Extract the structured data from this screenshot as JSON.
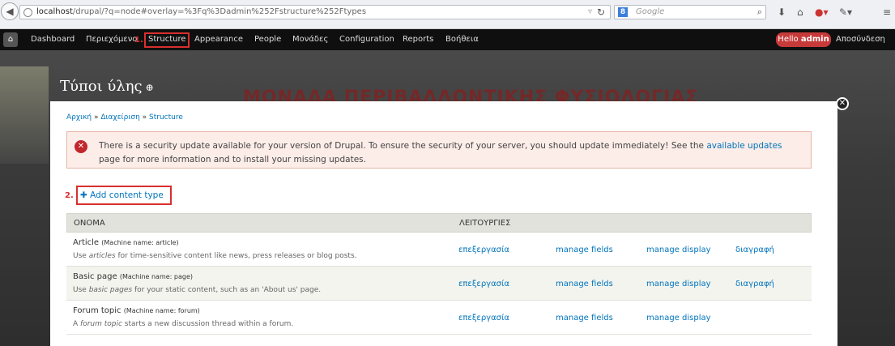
{
  "browser": {
    "url_host": "localhost",
    "url_rest": "/drupal/?q=node#overlay=%3Fq%3Dadmin%252Fstructure%252Ftypes",
    "search_placeholder": "Google",
    "search_engine_letter": "8"
  },
  "toolbar": {
    "items": [
      "Dashboard",
      "Περιεχόμενο",
      "Structure",
      "Appearance",
      "People",
      "Μονάδες",
      "Configuration",
      "Reports",
      "Βοήθεια"
    ],
    "step1": "1.",
    "hello_prefix": "Hello ",
    "hello_user": "admin",
    "logout": "Αποσύνδεση"
  },
  "background": {
    "banner": "ΜΟΝΑΔΑ ΠΕΡΙΒΑΛΛΟΝΤΙΚΗΣ ΦΥΣΙΟΛΟΓΙΑΣ",
    "page_title": "Τύποι ύλης",
    "page_title_icon": "⊕"
  },
  "overlay": {
    "breadcrumb": [
      "Αρχική",
      "Διαχείριση",
      "Structure"
    ],
    "breadcrumb_sep": " » ",
    "message_pre": "There is a security update available for your version of Drupal. To ensure the security of your server, you should update immediately! See the ",
    "message_link": "available updates",
    "message_post": " page for more information and to install your missing updates.",
    "step2": "2.",
    "add_link": "✚ Add content type"
  },
  "table": {
    "headers": [
      "ΟΝΟΜΑ",
      "ΛΕΙΤΟΥΡΓΙΕΣ"
    ],
    "rows": [
      {
        "name": "Article",
        "machine": "(Machine name: article)",
        "desc_pre": "Use ",
        "desc_em": "articles",
        "desc_post": " for time-sensitive content like news, press releases or blog posts.",
        "ops": [
          "επεξεργασία",
          "manage fields",
          "manage display",
          "διαγραφή"
        ]
      },
      {
        "name": "Basic page",
        "machine": "(Machine name: page)",
        "desc_pre": "Use ",
        "desc_em": "basic pages",
        "desc_post": " for your static content, such as an 'About us' page.",
        "ops": [
          "επεξεργασία",
          "manage fields",
          "manage display",
          "διαγραφή"
        ]
      },
      {
        "name": "Forum topic",
        "machine": "(Machine name: forum)",
        "desc_pre": "A ",
        "desc_em": "forum topic",
        "desc_post": " starts a new discussion thread within a forum.",
        "ops": [
          "επεξεργασία",
          "manage fields",
          "manage display"
        ]
      }
    ]
  },
  "colors": {
    "link": "#0074bd",
    "annotation": "#d92f2f",
    "toolbar_bg": "#0f0f0f",
    "error_bg": "#fcede8"
  }
}
